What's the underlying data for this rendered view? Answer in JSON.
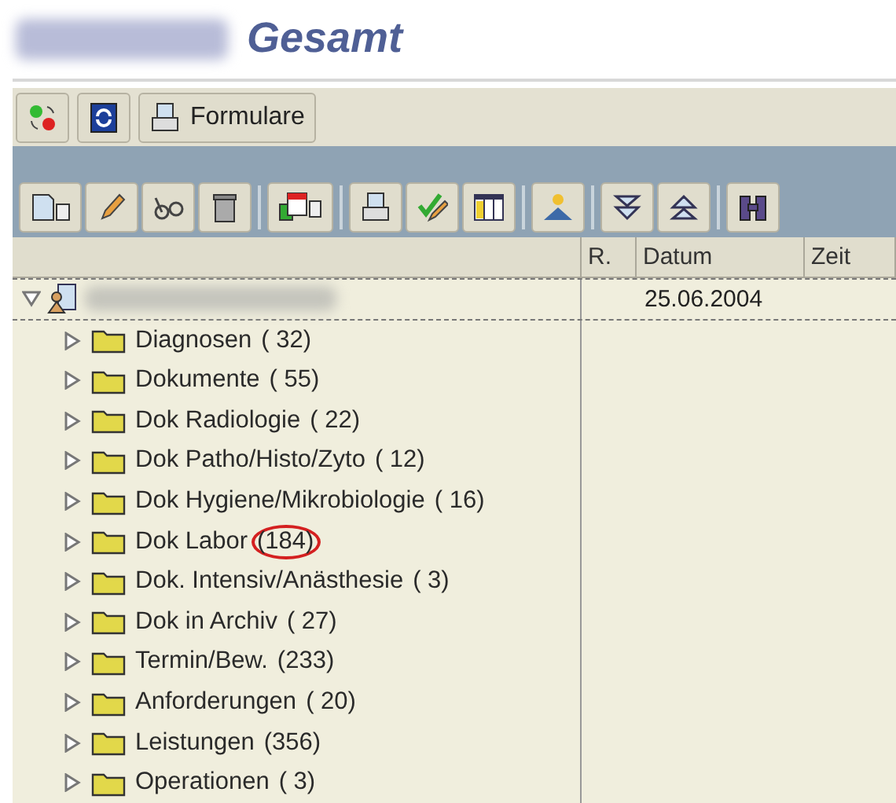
{
  "window": {
    "title": "Gesamt"
  },
  "toolbar": {
    "formulare_button": "Formulare"
  },
  "columns": [
    {
      "label": "R."
    },
    {
      "label": "Datum"
    },
    {
      "label": "Zeit"
    }
  ],
  "root": {
    "expanded": true,
    "date": "25.06.2004"
  },
  "items": [
    {
      "label": "Diagnosen",
      "count": "( 32)",
      "highlighted": false
    },
    {
      "label": "Dokumente",
      "count": "( 55)",
      "highlighted": false
    },
    {
      "label": "Dok Radiologie",
      "count": "( 22)",
      "highlighted": false
    },
    {
      "label": "Dok Patho/Histo/Zyto",
      "count": "( 12)",
      "highlighted": false
    },
    {
      "label": "Dok Hygiene/Mikrobiologie",
      "count": "( 16)",
      "highlighted": false
    },
    {
      "label": "Dok Labor",
      "count": "(184)",
      "highlighted": true
    },
    {
      "label": "Dok. Intensiv/Anästhesie",
      "count": "(  3)",
      "highlighted": false
    },
    {
      "label": "Dok in Archiv",
      "count": "( 27)",
      "highlighted": false
    },
    {
      "label": "Termin/Bew.",
      "count": "(233)",
      "highlighted": false
    },
    {
      "label": "Anforderungen",
      "count": "( 20)",
      "highlighted": false
    },
    {
      "label": "Leistungen",
      "count": "(356)",
      "highlighted": false
    },
    {
      "label": "Operationen",
      "count": "(  3)",
      "highlighted": false
    }
  ]
}
